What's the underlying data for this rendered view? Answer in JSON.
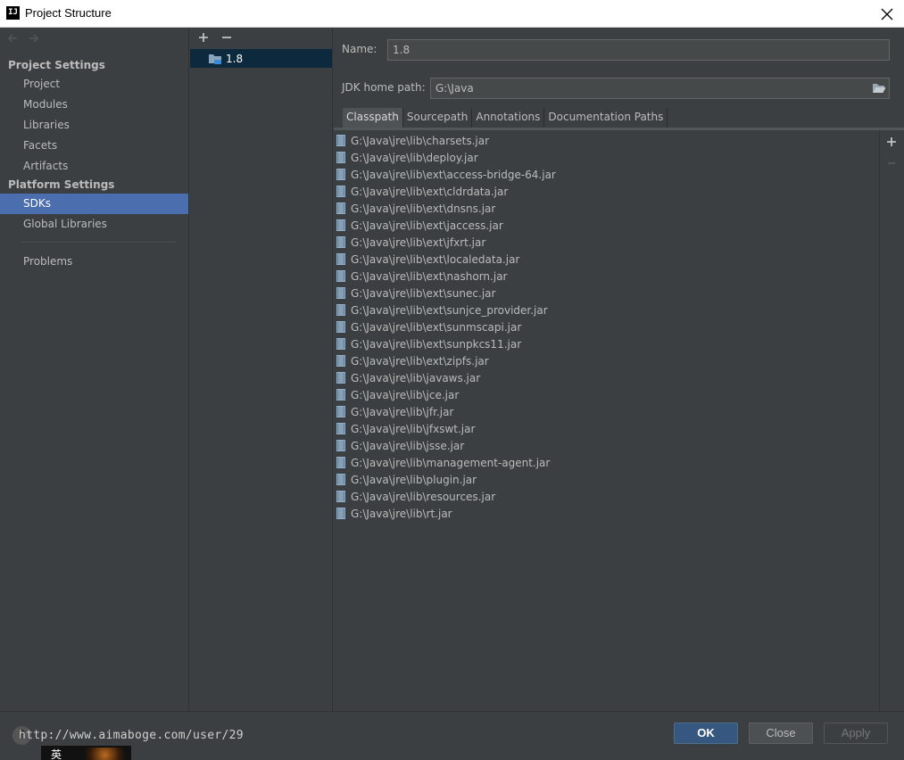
{
  "window": {
    "title": "Project Structure",
    "logo_text": "IJ"
  },
  "sidebar": {
    "project_settings_header": "Project Settings",
    "project_settings_items": [
      "Project",
      "Modules",
      "Libraries",
      "Facets",
      "Artifacts"
    ],
    "platform_settings_header": "Platform Settings",
    "platform_settings_items": [
      "SDKs",
      "Global Libraries"
    ],
    "selected_item": "SDKs",
    "other_items": [
      "Problems"
    ]
  },
  "sdk_list": {
    "items": [
      "1.8"
    ],
    "selected": "1.8"
  },
  "sdk_details": {
    "name_label": "Name:",
    "name_value": "1.8",
    "jdk_home_label": "JDK home path:",
    "jdk_home_value": "G:\\Java"
  },
  "tabs": {
    "items": [
      "Classpath",
      "Sourcepath",
      "Annotations",
      "Documentation Paths"
    ],
    "active": "Classpath"
  },
  "classpath": [
    "G:\\Java\\jre\\lib\\charsets.jar",
    "G:\\Java\\jre\\lib\\deploy.jar",
    "G:\\Java\\jre\\lib\\ext\\access-bridge-64.jar",
    "G:\\Java\\jre\\lib\\ext\\cldrdata.jar",
    "G:\\Java\\jre\\lib\\ext\\dnsns.jar",
    "G:\\Java\\jre\\lib\\ext\\jaccess.jar",
    "G:\\Java\\jre\\lib\\ext\\jfxrt.jar",
    "G:\\Java\\jre\\lib\\ext\\localedata.jar",
    "G:\\Java\\jre\\lib\\ext\\nashorn.jar",
    "G:\\Java\\jre\\lib\\ext\\sunec.jar",
    "G:\\Java\\jre\\lib\\ext\\sunjce_provider.jar",
    "G:\\Java\\jre\\lib\\ext\\sunmscapi.jar",
    "G:\\Java\\jre\\lib\\ext\\sunpkcs11.jar",
    "G:\\Java\\jre\\lib\\ext\\zipfs.jar",
    "G:\\Java\\jre\\lib\\javaws.jar",
    "G:\\Java\\jre\\lib\\jce.jar",
    "G:\\Java\\jre\\lib\\jfr.jar",
    "G:\\Java\\jre\\lib\\jfxswt.jar",
    "G:\\Java\\jre\\lib\\jsse.jar",
    "G:\\Java\\jre\\lib\\management-agent.jar",
    "G:\\Java\\jre\\lib\\plugin.jar",
    "G:\\Java\\jre\\lib\\resources.jar",
    "G:\\Java\\jre\\lib\\rt.jar"
  ],
  "footer": {
    "help_label": "?",
    "watermark": "http://www.aimaboge.com/user/29",
    "ok_label": "OK",
    "close_label": "Close",
    "apply_label": "Apply",
    "ime_char": "英"
  },
  "icons": {
    "back": "back-arrow-icon",
    "forward": "forward-arrow-icon",
    "add": "plus-icon",
    "remove": "minus-icon",
    "sdk": "sdk-folder-icon",
    "browse": "folder-open-icon",
    "jar": "jar-icon",
    "close": "close-icon"
  },
  "colors": {
    "background": "#3c3f41",
    "selection": "#4b6eaf",
    "sdk_selection": "#0d293e",
    "primary_button": "#365880",
    "text": "#bbbbbb"
  }
}
